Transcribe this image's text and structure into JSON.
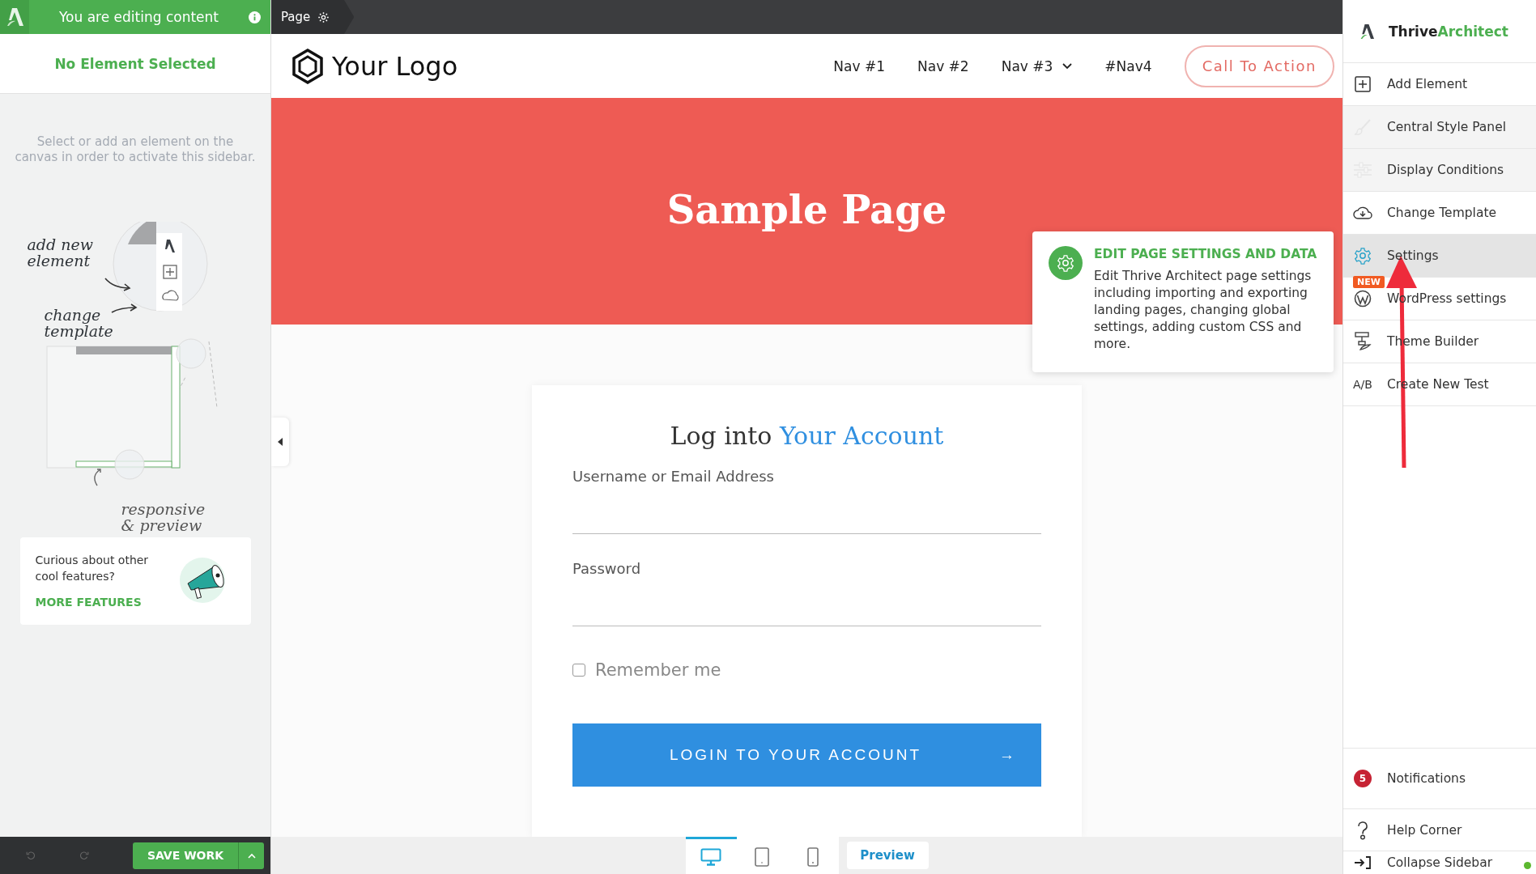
{
  "editor_bar": {
    "status": "You are editing content",
    "breadcrumb": "Page"
  },
  "left_sidebar": {
    "title": "No Element Selected",
    "hint": "Select or add an element on the canvas in order to activate this sidebar.",
    "illustration_labels": [
      {
        "kind": "add",
        "text": "add new element"
      },
      {
        "kind": "template",
        "text": "change template"
      },
      {
        "kind": "responsive",
        "text": "responsive & preview"
      }
    ],
    "promo": {
      "text": "Curious about other cool features?",
      "link": "MORE FEATURES"
    },
    "save_button": "SAVE WORK"
  },
  "site_header": {
    "logo": "Your Logo",
    "nav": [
      {
        "label": "Nav #1",
        "has_menu": false
      },
      {
        "label": "Nav #2",
        "has_menu": false
      },
      {
        "label": "Nav #3",
        "has_menu": true
      },
      {
        "label": "#Nav4",
        "has_menu": false
      }
    ],
    "cta": "Call To Action"
  },
  "hero": {
    "title": "Sample Page"
  },
  "login_form": {
    "heading": "Log into",
    "heading_highlight": "Your Account",
    "fields": [
      {
        "label": "Username or Email Address"
      },
      {
        "label": "Password"
      }
    ],
    "remember": {
      "label": "Remember me",
      "checked": false
    },
    "submit": "LOGIN TO YOUR ACCOUNT",
    "submit_icon": "→"
  },
  "tooltip": {
    "title": "EDIT PAGE SETTINGS AND DATA",
    "body": "Edit Thrive Architect page settings including importing and exporting landing pages, changing global settings, adding custom CSS and more."
  },
  "right_sidebar": {
    "brand": "Thrive",
    "brand_highlight": "Architect",
    "menu": [
      {
        "label": "Add Element",
        "kind": "plus",
        "selected": false,
        "disabled": false
      },
      {
        "label": "Central Style Panel",
        "kind": "brush",
        "selected": false,
        "disabled": true
      },
      {
        "label": "Display Conditions",
        "kind": "sliders",
        "selected": false,
        "disabled": true
      },
      {
        "label": "Change Template",
        "kind": "cloud",
        "selected": false,
        "disabled": false
      },
      {
        "label": "Settings",
        "kind": "gear",
        "selected": true,
        "disabled": false
      },
      {
        "label": "WordPress settings",
        "kind": "wordpress",
        "selected": false,
        "disabled": false,
        "badge": "NEW"
      },
      {
        "label": "Theme Builder",
        "kind": "theme",
        "selected": false,
        "disabled": false
      },
      {
        "label": "Create New Test",
        "kind": "text",
        "icon_text": "A/B",
        "selected": false,
        "disabled": false
      }
    ],
    "bottom": [
      {
        "label": "Notifications",
        "kind": "count",
        "count": "5"
      },
      {
        "label": "Help Corner",
        "kind": "help"
      },
      {
        "label": "Collapse Sidebar",
        "kind": "collapse"
      }
    ]
  },
  "devices": [
    {
      "kind": "desktop",
      "selected": true
    },
    {
      "kind": "tablet",
      "selected": false
    },
    {
      "kind": "mobile",
      "selected": false
    }
  ],
  "preview": "Preview"
}
